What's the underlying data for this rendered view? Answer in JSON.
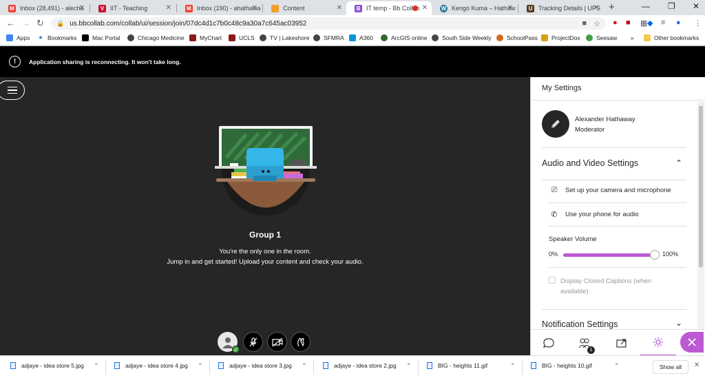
{
  "tabs": [
    {
      "title": "Inbox (28,491) - alecha",
      "icon_color": "#ea4335",
      "icon_glyph": "M"
    },
    {
      "title": "IIT - Teaching",
      "icon_color": "#c8102e",
      "icon_glyph": "V"
    },
    {
      "title": "Inbox (190) - ahathawa",
      "icon_color": "#ea4335",
      "icon_glyph": "M"
    },
    {
      "title": "Content",
      "icon_color": "#f0a030",
      "icon_glyph": ""
    },
    {
      "title": "IT temp - Bb Collab",
      "icon_color": "#8a4fd8",
      "icon_glyph": "B"
    },
    {
      "title": "Kengo Kuma – Hathaw",
      "icon_color": "#21759b",
      "icon_glyph": "W"
    },
    {
      "title": "Tracking Details | UPS",
      "icon_color": "#5a3a1e",
      "icon_glyph": "U"
    }
  ],
  "new_tab": "+",
  "window_controls": {
    "minimize": "—",
    "maximize": "❐",
    "close": "✕"
  },
  "address": {
    "url": "us.bbcollab.com/collab/ui/session/join/07dc4d1c7b0c48c9a30a7c645ac03952"
  },
  "bookmarks": [
    {
      "label": "Apps",
      "color": "#4285f4",
      "glyph": "▦"
    },
    {
      "label": "Bookmarks",
      "color": "#1a73e8",
      "glyph": "★"
    },
    {
      "label": "Mac Portal",
      "color": "#000000",
      "glyph": "M"
    },
    {
      "label": "Chicago Medicine",
      "color": "#444444",
      "glyph": "●"
    },
    {
      "label": "MyChart",
      "color": "#8b1a1a",
      "glyph": "U"
    },
    {
      "label": "UCLS",
      "color": "#8b1a1a",
      "glyph": "U"
    },
    {
      "label": "TV | Lakeshore",
      "color": "#444444",
      "glyph": "●"
    },
    {
      "label": "SFMRA",
      "color": "#444444",
      "glyph": "●"
    },
    {
      "label": "A360",
      "color": "#0696d7",
      "glyph": "A"
    },
    {
      "label": "ArcGIS online",
      "color": "#2d6a2d",
      "glyph": "●"
    },
    {
      "label": "South Side Weekly",
      "color": "#444444",
      "glyph": "●"
    },
    {
      "label": "SchoolPass",
      "color": "#d2691e",
      "glyph": "●"
    },
    {
      "label": "ProjectDox",
      "color": "#d4a017",
      "glyph": "X"
    },
    {
      "label": "Seesaw",
      "color": "#43a047",
      "glyph": "∞"
    },
    {
      "label": "»",
      "color": "",
      "glyph": ""
    },
    {
      "label": "Other bookmarks",
      "color": "#f2c94c",
      "glyph": ""
    }
  ],
  "banner": {
    "message": "Application sharing is reconnecting. It won't take long."
  },
  "room": {
    "title": "Group 1",
    "line1": "You're the only one in the room.",
    "line2": "Jump in and get started! Upload your content and check your audio."
  },
  "panel": {
    "title": "My Settings",
    "user": {
      "name": "Alexander Hathaway",
      "role": "Moderator"
    },
    "audio_video": {
      "title": "Audio and Video Settings",
      "camera_link": "Set up your camera and microphone",
      "phone_link": "Use your phone for audio",
      "speaker_volume_label": "Speaker Volume",
      "volume_min": "0%",
      "volume_max": "100%",
      "volume_value": 1.0,
      "closed_captions": "Display Closed Captions (when available)"
    },
    "notification_title": "Notification Settings",
    "participants_count": "1"
  },
  "downloads": [
    {
      "name": "adjaye - idea store 5.jpg"
    },
    {
      "name": "adjaye - idea store 4.jpg"
    },
    {
      "name": "adjaye - idea store 3.jpg"
    },
    {
      "name": "adjaye - idea store 2.jpg"
    },
    {
      "name": "BIG - heights 11.gif"
    },
    {
      "name": "BIG - heights 10.gif"
    }
  ],
  "show_all": "Show all",
  "accent": "#bb5ad1"
}
